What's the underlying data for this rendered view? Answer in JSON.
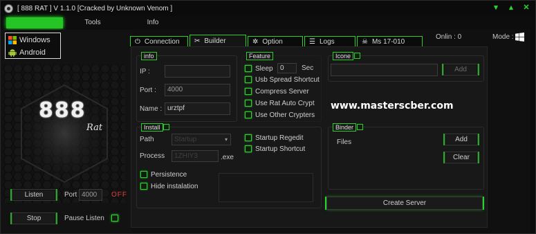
{
  "window": {
    "title": "[ 888 RAT ] V 1.1.0 [Cracked by Unknown Venom ]",
    "controls": [
      "▾",
      "▴",
      "✕"
    ]
  },
  "menu": {
    "items": [
      {
        "label": "",
        "active": true
      },
      {
        "label": "Tools",
        "active": false
      },
      {
        "label": "Info",
        "active": false
      }
    ]
  },
  "sidebar": {
    "os_options": [
      {
        "label": "Windows",
        "icon": "windows-icon"
      },
      {
        "label": "Android",
        "icon": "android-icon"
      }
    ],
    "logo_number": "888",
    "logo_word": "Rat",
    "listen_label": "Listen",
    "port_label": "Port",
    "port_value": "4000",
    "status_text": "OFF",
    "stop_label": "Stop",
    "pause_label": "Pause Listen"
  },
  "header": {
    "online_label": "Onlin : 0",
    "mode_label": "Mode :"
  },
  "tabs": [
    {
      "label": "Connection",
      "icon": "plug-icon",
      "active": false
    },
    {
      "label": "Builder",
      "icon": "tools-icon",
      "active": true
    },
    {
      "label": "Option",
      "icon": "gear-icon",
      "active": false
    },
    {
      "label": "Logs",
      "icon": "log-icon",
      "active": false
    },
    {
      "label": "Ms 17-010",
      "icon": "skull-icon",
      "active": false
    }
  ],
  "info": {
    "title": "info",
    "ip_label": "IP :",
    "ip_value": "",
    "port_label": "Port :",
    "port_value": "4000",
    "name_label": "Name :",
    "name_value": "urztpf"
  },
  "feature": {
    "title": "Feature",
    "sleep_label": "Sleep",
    "sleep_value": "0",
    "sleep_unit": "Sec",
    "options": [
      "Usb Spread Shortcut",
      "Compress Server",
      "Use Rat Auto Crypt",
      "Use Other Crypters"
    ]
  },
  "icone": {
    "title": "Icone",
    "path_value": "",
    "add_label": "Add"
  },
  "install": {
    "title": "Install",
    "path_label": "Path",
    "path_value": "Startup",
    "process_label": "Process",
    "process_value": "1ZHIY3",
    "process_ext": ".exe",
    "persistence_label": "Persistence",
    "hide_label": "Hide instalation",
    "startup_regedit": "Startup Regedit",
    "startup_shortcut": "Startup Shortcut"
  },
  "binder": {
    "title": "Binder",
    "files_header": "Files",
    "add_label": "Add",
    "clear_label": "Clear"
  },
  "watermark": "www.masterscber.com",
  "create_server_label": "Create Server",
  "colors": {
    "accent": "#2ccf2c",
    "background": "#101010",
    "off": "#e23a3a"
  }
}
